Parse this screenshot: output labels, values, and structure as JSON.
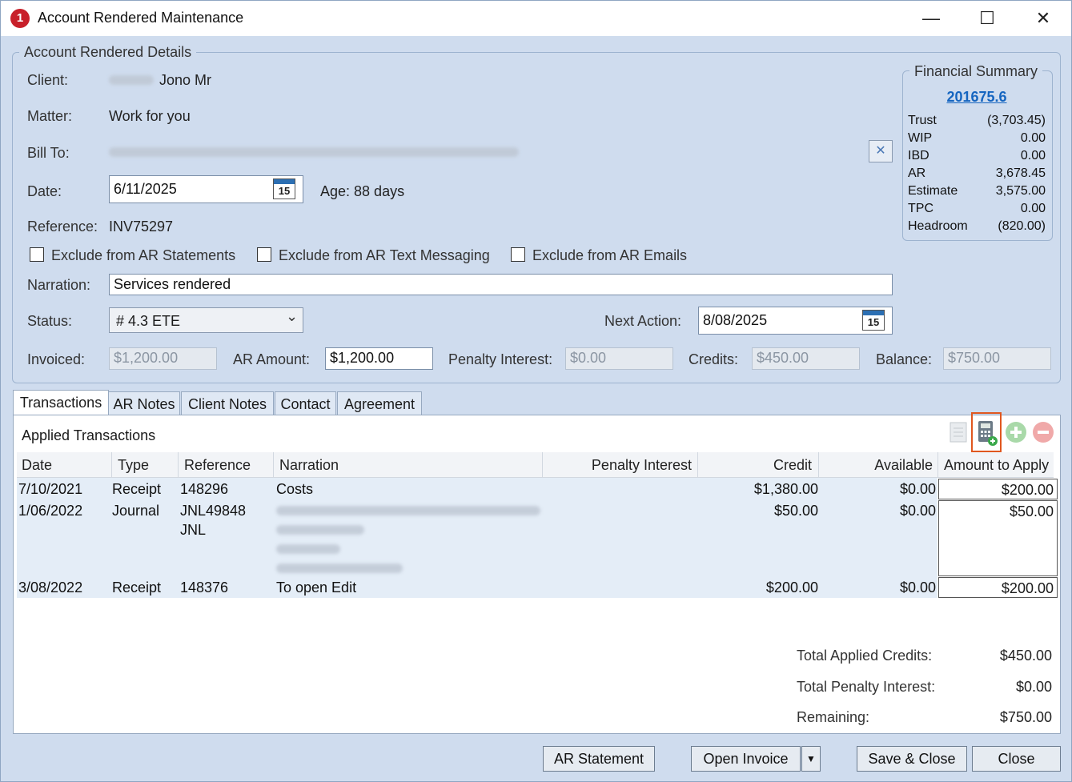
{
  "window": {
    "title": "Account Rendered Maintenance",
    "minimize": "—",
    "maximize": "☐",
    "close": "✕"
  },
  "details": {
    "legend": "Account Rendered Details",
    "client_label": "Client:",
    "client_value": "Jono Mr",
    "matter_label": "Matter:",
    "matter_value": "Work for you",
    "billto_label": "Bill To:",
    "date_label": "Date:",
    "date_value": "6/11/2025",
    "age_text": "Age: 88 days",
    "reference_label": "Reference:",
    "reference_value": "INV75297",
    "cal_day": "15",
    "clear_icon": "✕",
    "chk_statements": "Exclude from AR Statements",
    "chk_text": "Exclude from AR Text Messaging",
    "chk_emails": "Exclude from AR Emails",
    "narration_label": "Narration:",
    "narration_value": "Services rendered",
    "status_label": "Status:",
    "status_value": "# 4.3 ETE",
    "status_chevron": "⌄",
    "next_action_label": "Next Action:",
    "next_action_value": "8/08/2025",
    "invoiced_label": "Invoiced:",
    "invoiced_value": "$1,200.00",
    "ar_amount_label": "AR Amount:",
    "ar_amount_value": "$1,200.00",
    "penalty_label": "Penalty Interest:",
    "penalty_value": "$0.00",
    "credits_label": "Credits:",
    "credits_value": "$450.00",
    "balance_label": "Balance:",
    "balance_value": "$750.00"
  },
  "financial": {
    "legend": "Financial Summary",
    "matter_link": "201675.6",
    "rows": [
      {
        "label": "Trust",
        "value": "(3,703.45)"
      },
      {
        "label": "WIP",
        "value": "0.00"
      },
      {
        "label": "IBD",
        "value": "0.00"
      },
      {
        "label": "AR",
        "value": "3,678.45"
      },
      {
        "label": "Estimate",
        "value": "3,575.00"
      },
      {
        "label": "TPC",
        "value": "0.00"
      },
      {
        "label": "Headroom",
        "value": "(820.00)"
      }
    ]
  },
  "tabs": [
    "Transactions",
    "AR Notes",
    "Client Notes",
    "Contact",
    "Agreement"
  ],
  "transactions": {
    "heading": "Applied Transactions",
    "columns": [
      "Date",
      "Type",
      "Reference",
      "Narration",
      "Penalty Interest",
      "Credit",
      "Available",
      "Amount to Apply"
    ],
    "rows": [
      {
        "date": "7/10/2021",
        "type": "Receipt",
        "reference": "148296",
        "reference2": "",
        "narration": "Costs",
        "credit": "$1,380.00",
        "available": "$0.00",
        "apply": "$200.00"
      },
      {
        "date": "1/06/2022",
        "type": "Journal",
        "reference": "JNL49848",
        "reference2": "JNL",
        "narration": "",
        "credit": "$50.00",
        "available": "$0.00",
        "apply": "$50.00"
      },
      {
        "date": "3/08/2022",
        "type": "Receipt",
        "reference": "148376",
        "reference2": "",
        "narration": "To open Edit",
        "credit": "$200.00",
        "available": "$0.00",
        "apply": "$200.00"
      }
    ],
    "totals": [
      {
        "label": "Total Applied Credits:",
        "value": "$450.00"
      },
      {
        "label": "Total Penalty Interest:",
        "value": "$0.00"
      },
      {
        "label": "Remaining:",
        "value": "$750.00"
      }
    ]
  },
  "buttons": {
    "ar_statement": "AR Statement",
    "open_invoice": "Open Invoice",
    "open_invoice_arrow": "▼",
    "save_close": "Save & Close",
    "close": "Close"
  },
  "colors": {
    "accent_link": "#1565c0",
    "highlight": "#e0571f",
    "window_bg": "#cfdcee"
  }
}
